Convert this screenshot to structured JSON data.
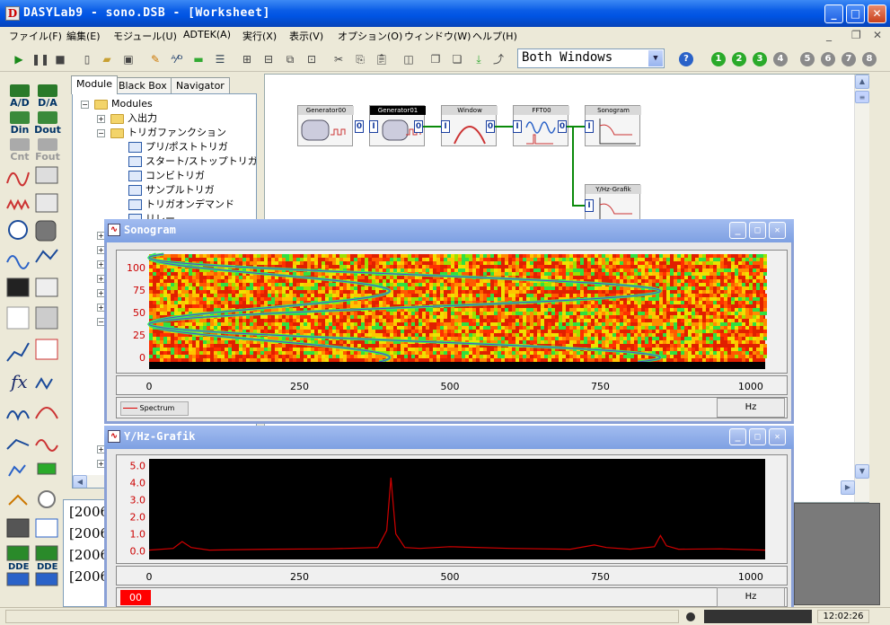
{
  "window": {
    "title": "DASYLab9 - sono.DSB - [Worksheet]",
    "app_icon": "D"
  },
  "menu": [
    "ファイル(F)",
    "編集(E)",
    "モジュール(U)",
    "ADTEK(A)",
    "実行(X)",
    "表示(V)",
    "オプション(O)",
    "ウィンドウ(W)",
    "ヘルプ(H)"
  ],
  "toolbar": {
    "view_select": "Both Windows",
    "help": "?",
    "layers": [
      "1",
      "2",
      "3",
      "4",
      "5",
      "6",
      "7",
      "8"
    ]
  },
  "palette": [
    {
      "label": "A/D",
      "icon": "ad-icon"
    },
    {
      "label": "D/A",
      "icon": "da-icon"
    },
    {
      "label": "Din",
      "icon": "din-icon"
    },
    {
      "label": "Dout",
      "icon": "dout-icon"
    },
    {
      "label": "Cnt",
      "icon": "counter-icon"
    },
    {
      "label": "Fout",
      "icon": "fout-icon"
    }
  ],
  "browser": {
    "tabs": [
      "Module",
      "Black Box",
      "Navigator"
    ],
    "tree": {
      "root": "Modules",
      "items": [
        {
          "label": "入出力",
          "type": "folder"
        },
        {
          "label": "トリガファンクション",
          "type": "folder-open"
        },
        {
          "label": "プリ/ポストトリガ",
          "type": "module"
        },
        {
          "label": "スタート/ストップトリガ",
          "type": "module"
        },
        {
          "label": "コンビトリガ",
          "type": "module"
        },
        {
          "label": "サンプルトリガ",
          "type": "module"
        },
        {
          "label": "トリガオンデマンド",
          "type": "module"
        },
        {
          "label": "リレー",
          "type": "module"
        }
      ]
    }
  },
  "worksheet": {
    "modules": [
      {
        "name": "Generator00",
        "selected": false
      },
      {
        "name": "Generator01",
        "selected": true
      },
      {
        "name": "Window",
        "selected": false
      },
      {
        "name": "FFT00",
        "selected": false
      },
      {
        "name": "Sonogram",
        "selected": false
      },
      {
        "name": "Y/Hz-Grafik",
        "selected": false
      }
    ],
    "port_in": "I",
    "port_out": "0"
  },
  "sonogram": {
    "title": "Sonogram",
    "legend": "Spectrum",
    "unit": "Hz",
    "chart_data": {
      "type": "heatmap",
      "title": "",
      "x_ticks": [
        0,
        250,
        500,
        750,
        1000
      ],
      "y_ticks": [
        0,
        25,
        50,
        75,
        100
      ],
      "xlim": [
        0,
        1024
      ],
      "ylim": [
        -5,
        115
      ],
      "tones": [
        {
          "freq_hz": 400,
          "time_max": 115
        },
        {
          "freq_hz": 850,
          "time_max": 115
        }
      ]
    }
  },
  "yhz": {
    "title": "Y/Hz-Grafik",
    "channel": "00",
    "unit": "Hz",
    "chart_data": {
      "type": "line",
      "title": "",
      "x_ticks": [
        0,
        250,
        500,
        750,
        1000
      ],
      "y_ticks": [
        "5.0",
        "4.0",
        "3.0",
        "2.0",
        "1.0",
        "0.0"
      ],
      "xlim": [
        0,
        1024
      ],
      "ylim": [
        -0.5,
        5.4
      ],
      "series": [
        {
          "x": [
            0,
            40,
            55,
            70,
            100,
            200,
            300,
            380,
            395,
            402,
            410,
            425,
            450,
            500,
            600,
            700,
            740,
            760,
            800,
            840,
            850,
            860,
            880,
            950,
            1024
          ],
          "y": [
            0.05,
            0.15,
            0.55,
            0.2,
            0.05,
            0.1,
            0.12,
            0.2,
            1.2,
            4.3,
            1.0,
            0.2,
            0.15,
            0.25,
            0.15,
            0.1,
            0.35,
            0.2,
            0.1,
            0.25,
            0.9,
            0.3,
            0.1,
            0.12,
            0.05
          ]
        }
      ],
      "line_color": "#d00000"
    }
  },
  "log": {
    "lines": [
      "[2006",
      "[2006",
      "[2006",
      "[2006"
    ]
  },
  "status": {
    "time": "12:02:26"
  }
}
